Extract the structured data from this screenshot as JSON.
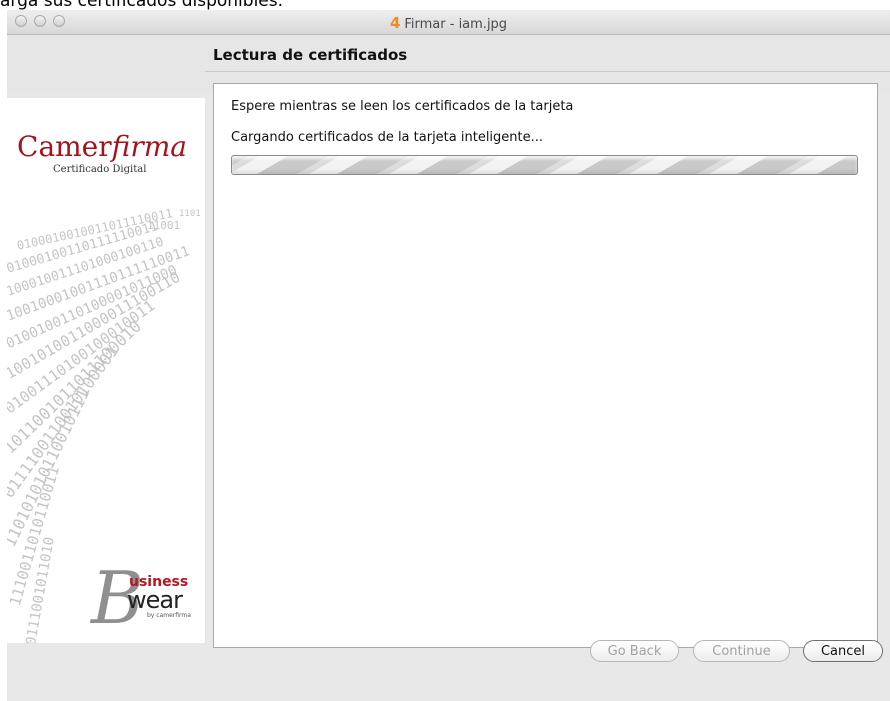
{
  "caption_fragment": "arga sus certificados disponibles.",
  "window": {
    "title": "Firmar - iam.jpg",
    "app_icon": "4"
  },
  "header": {
    "step_title": "Lectura de certificados"
  },
  "sidebar": {
    "logo_text_prefix": "C",
    "logo_text_rest": "amer",
    "logo_text_italic": "firma",
    "logo_subtitle": "Certificado Digital",
    "footer_logo_b": "B",
    "footer_logo_usiness": "usiness",
    "footer_logo_wear": "wear",
    "footer_logo_small": "by camerfirma"
  },
  "content": {
    "message_wait": "Espere mientras se leen los certificados de la tarjeta",
    "message_loading": "Cargando certificados de la tarjeta inteligente..."
  },
  "progress": {
    "indeterminate": true
  },
  "buttons": {
    "back": "Go Back",
    "continue": "Continue",
    "cancel": "Cancel"
  },
  "icons": {
    "window_close": "close-icon",
    "window_minimize": "minimize-icon",
    "window_zoom": "zoom-icon",
    "app": "app-icon"
  }
}
